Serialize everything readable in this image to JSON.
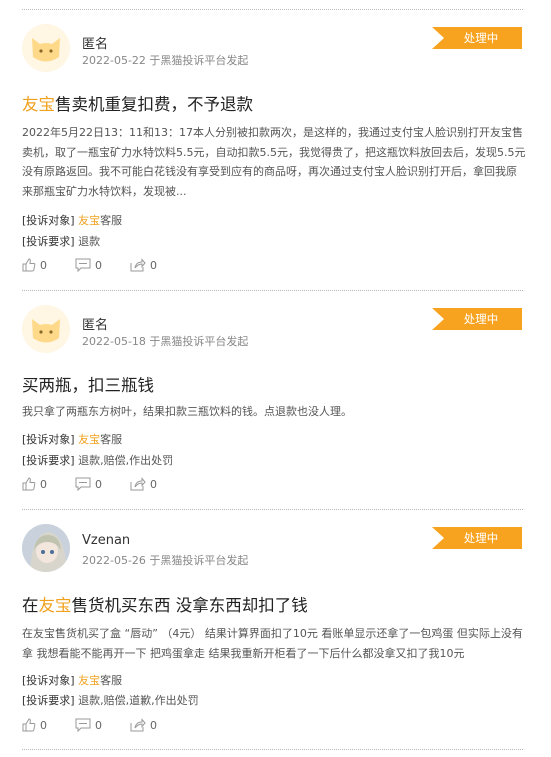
{
  "complaints": [
    {
      "user": "匿名",
      "date": "2022-05-22 于黑猫投诉平台发起",
      "status": "处理中",
      "title_brand": "友宝",
      "title_rest": "售卖机重复扣费，不予退款",
      "body": "2022年5月22日13：11和13：17本人分别被扣款两次，是这样的，我通过支付宝人脸识别打开友宝售卖机，取了一瓶宝矿力水特饮料5.5元，自动扣款5.5元，我觉得贵了，把这瓶饮料放回去后，发现5.5元没有原路返回。我不可能白花钱没有享受到应有的商品呀，再次通过支付宝人脸识别打开后，拿回我原来那瓶宝矿力水特饮料，发现被...",
      "target_label": "[投诉对象]",
      "target_brand": "友宝",
      "target_rest": "客服",
      "demand_label": "[投诉要求]",
      "demand": "退款",
      "likes": "0",
      "comments": "0",
      "shares": "0"
    },
    {
      "user": "匿名",
      "date": "2022-05-18 于黑猫投诉平台发起",
      "status": "处理中",
      "title_pre": "买两瓶，扣三瓶钱",
      "body": "我只拿了两瓶东方树叶，结果扣款三瓶饮料的钱。点退款也没人理。",
      "target_label": "[投诉对象]",
      "target_brand": "友宝",
      "target_rest": "客服",
      "demand_label": "[投诉要求]",
      "demand": "退款,赔偿,作出处罚",
      "likes": "0",
      "comments": "0",
      "shares": "0"
    },
    {
      "user": "Vzenan",
      "date": "2022-05-26 于黑猫投诉平台发起",
      "status": "处理中",
      "title_pre": "在",
      "title_brand": "友宝",
      "title_rest": "售货机买东西 没拿东西却扣了钱",
      "body": "在友宝售货机买了盒 “唇动” （4元） 结果计算界面扣了10元 看账单显示还拿了一包鸡蛋 但实际上没有拿 我想看能不能再开一下 把鸡蛋拿走 结果我重新开柜看了一下后什么都没拿又扣了我10元",
      "target_label": "[投诉对象]",
      "target_brand": "友宝",
      "target_rest": "客服",
      "demand_label": "[投诉要求]",
      "demand": "退款,赔偿,道歉,作出处罚",
      "likes": "0",
      "comments": "0",
      "shares": "0"
    }
  ]
}
